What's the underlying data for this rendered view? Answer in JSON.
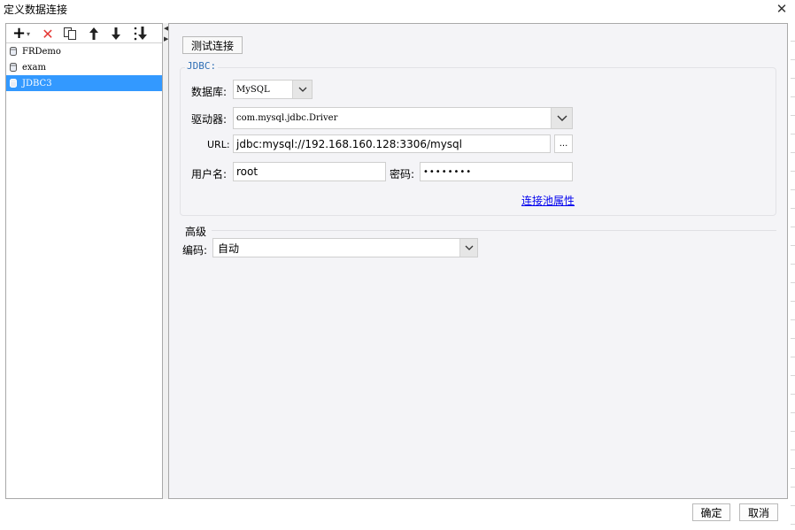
{
  "window": {
    "title": "定义数据连接",
    "close_glyph": "✕"
  },
  "toolbar": {
    "add_glyph": "+",
    "add_caret": "▾",
    "delete_glyph": "✕",
    "up_glyph": "🡑",
    "down_glyph": "🡓"
  },
  "connections": [
    {
      "label": "FRDemo"
    },
    {
      "label": "exam"
    },
    {
      "label": "JDBC3"
    }
  ],
  "selected_connection": "JDBC3",
  "colors": {
    "selection": "#3399ff",
    "delete_icon": "#e53935",
    "legend": "#2f6fb5",
    "link": "#0000ee"
  },
  "form": {
    "test_button": "测试连接",
    "jdbc_legend": "JDBC:",
    "database_label": "数据库:",
    "database_value": "MySQL",
    "driver_label": "驱动器:",
    "driver_value": "com.mysql.jdbc.Driver",
    "url_label": "URL:",
    "url_value": "jdbc:mysql://192.168.160.128:3306/mysql",
    "url_browse": "...",
    "username_label": "用户名:",
    "username_value": "root",
    "password_label": "密码:",
    "password_value": "••••••••",
    "pool_link": "连接池属性"
  },
  "advanced": {
    "title": "高级",
    "encoding_label": "编码:",
    "encoding_value": "自动"
  },
  "footer": {
    "ok": "确定",
    "cancel": "取消"
  },
  "icons": {
    "add": "plus-icon",
    "delete": "delete-icon",
    "copy": "copy-icon",
    "up": "arrow-up-icon",
    "down": "arrow-down-icon",
    "sort": "sort-icon",
    "db": "database-icon",
    "dropdown": "chevron-down-icon"
  }
}
